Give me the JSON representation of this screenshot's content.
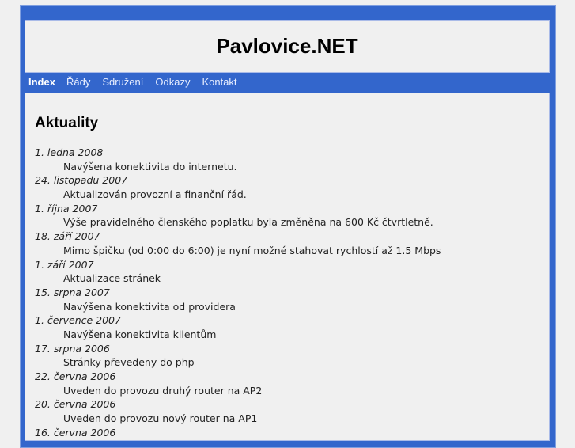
{
  "site_title": "Pavlovice.NET",
  "nav": [
    {
      "label": "Index",
      "active": true
    },
    {
      "label": "Řády"
    },
    {
      "label": "Sdružení"
    },
    {
      "label": "Odkazy"
    },
    {
      "label": "Kontakt"
    }
  ],
  "heading": "Aktuality",
  "news": [
    {
      "date": "1. ledna 2008",
      "text": "Navýšena konektivita do internetu."
    },
    {
      "date": "24. listopadu 2007",
      "text": "Aktualizován provozní a finanční řád."
    },
    {
      "date": "1. října 2007",
      "text": "Výše pravidelného členského poplatku byla změněna na 600 Kč čtvrtletně."
    },
    {
      "date": "18. září 2007",
      "text": "Mimo špičku (od 0:00 do 6:00) je nyní možné stahovat rychlostí až 1.5 Mbps"
    },
    {
      "date": "1. září 2007",
      "text": "Aktualizace stránek"
    },
    {
      "date": "15. srpna 2007",
      "text": "Navýšena konektivita od providera"
    },
    {
      "date": "1. července 2007",
      "text": "Navýšena konektivita klientům"
    },
    {
      "date": "17. srpna 2006",
      "text": "Stránky převedeny do php"
    },
    {
      "date": "22. června 2006",
      "text": "Uveden do provozu druhý router na AP2"
    },
    {
      "date": "20. června 2006",
      "text": "Uveden do provozu nový router na AP1"
    },
    {
      "date": "16. června 2006",
      "text": ""
    }
  ]
}
